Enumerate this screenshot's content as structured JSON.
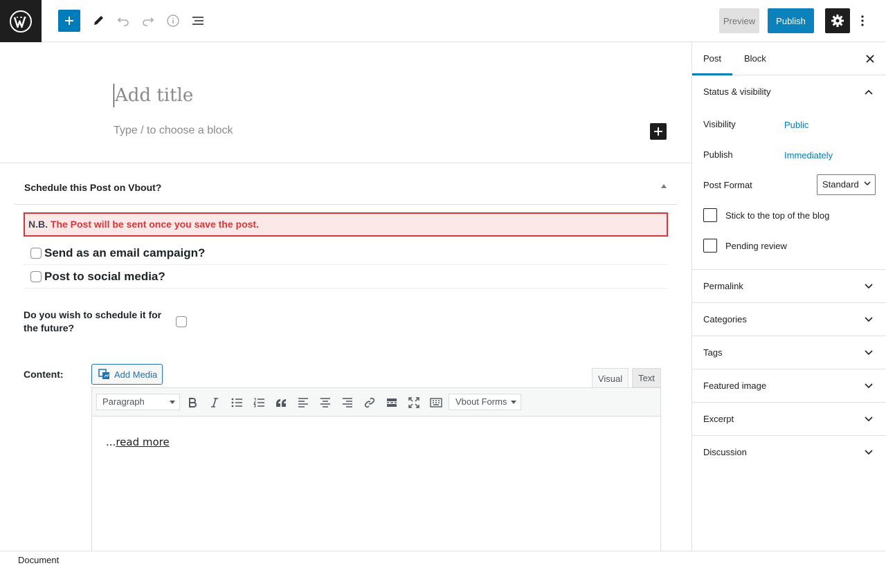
{
  "topbar": {
    "preview_label": "Preview",
    "publish_label": "Publish"
  },
  "editor": {
    "title_placeholder": "Add title",
    "block_placeholder": "Type / to choose a block"
  },
  "metabox": {
    "title": "Schedule this Post on Vbout?",
    "notice_prefix": "N.B.",
    "notice_message": "The Post will be sent once you save the post.",
    "email_campaign_label": "Send as an email campaign?",
    "social_media_label": "Post to social media?",
    "schedule_question": "Do you wish to schedule it for the future?",
    "content_label": "Content:",
    "add_media_label": "Add Media",
    "tab_visual": "Visual",
    "tab_text": "Text",
    "format_select_value": "Paragraph",
    "vbout_forms_label": "Vbout Forms",
    "body_prefix": "...",
    "read_more": "read more"
  },
  "sidebar": {
    "tab_post": "Post",
    "tab_block": "Block",
    "status_title": "Status & visibility",
    "visibility_label": "Visibility",
    "visibility_value": "Public",
    "publish_label": "Publish",
    "publish_value": "Immediately",
    "post_format_label": "Post Format",
    "post_format_value": "Standard",
    "stick_top_label": "Stick to the top of the blog",
    "pending_review_label": "Pending review",
    "panels": [
      "Permalink",
      "Categories",
      "Tags",
      "Featured image",
      "Excerpt",
      "Discussion"
    ]
  },
  "footer": {
    "breadcrumb": "Document"
  },
  "colors": {
    "accent": "#007cba",
    "dark": "#1e1e1e",
    "notice_border": "#d63638",
    "notice_bg": "#fde8e8"
  }
}
